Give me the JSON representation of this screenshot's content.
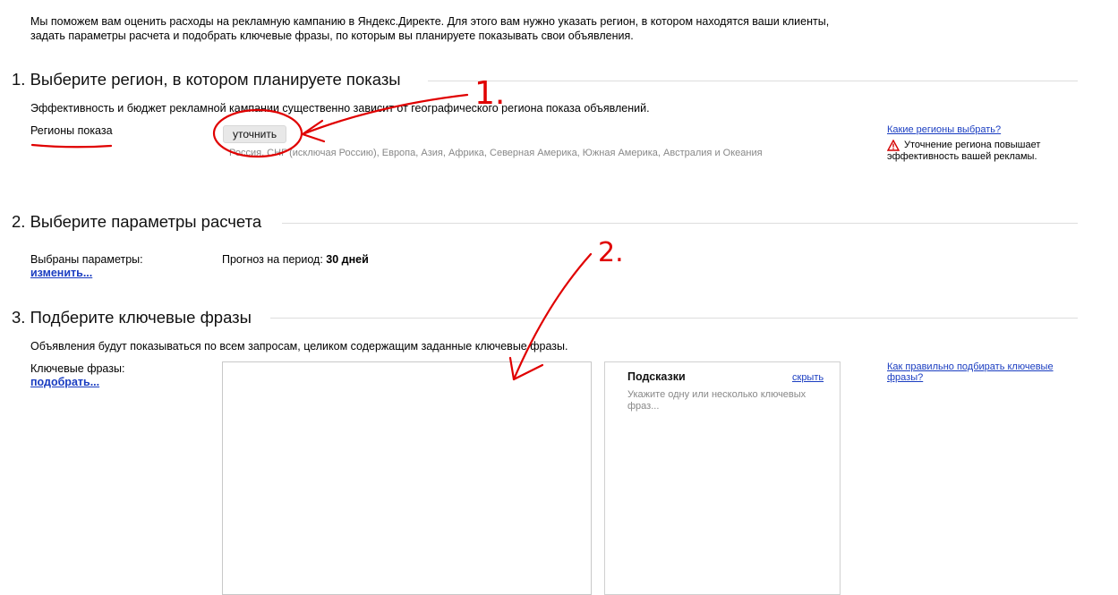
{
  "intro": {
    "line1": "Мы поможем вам оценить расходы на рекламную кампанию в Яндекс.Директе. Для этого вам нужно указать регион, в котором находятся ваши клиенты,",
    "line2": "задать параметры расчета и подобрать ключевые фразы, по которым вы планируете показывать свои объявления."
  },
  "section1": {
    "title": "1. Выберите регион, в котором планируете показы",
    "description": "Эффективность и бюджет рекламной кампании существенно зависит от географического региона показа объявлений.",
    "regions_label": "Регионы показа",
    "refine_button": "уточнить",
    "regions_value": "Россия, СНГ (исключая Россию), Европа, Азия, Африка, Северная Америка, Южная Америка, Австралия и Океания",
    "help_link": "Какие регионы выбрать?",
    "warning_line1": "Уточнение региона повышает",
    "warning_line2": "эффективность вашей рекламы."
  },
  "section2": {
    "title": "2. Выберите параметры расчета",
    "params_label": "Выбраны параметры:",
    "change_link": "изменить...",
    "forecast_label": "Прогноз на период:",
    "forecast_value": "30 дней"
  },
  "section3": {
    "title": "3. Подберите ключевые фразы",
    "description": "Объявления будут показываться по всем запросам, целиком содержащим заданные ключевые фразы.",
    "phrases_label": "Ключевые фразы:",
    "pick_link": "подобрать...",
    "phrases_value": "",
    "hints_title": "Подсказки",
    "hide_link": "скрыть",
    "hints_text_line1": "Укажите одну или несколько ключевых",
    "hints_text_line2": "фраз...",
    "help_link_line1": "Как правильно подбирать ключевые",
    "help_link_line2": "фразы?"
  },
  "annotations": {
    "mark1": "1.",
    "mark2": "2."
  },
  "colors": {
    "link": "#1a3dc1",
    "annotation": "#e00000",
    "rule": "#dddddd"
  }
}
